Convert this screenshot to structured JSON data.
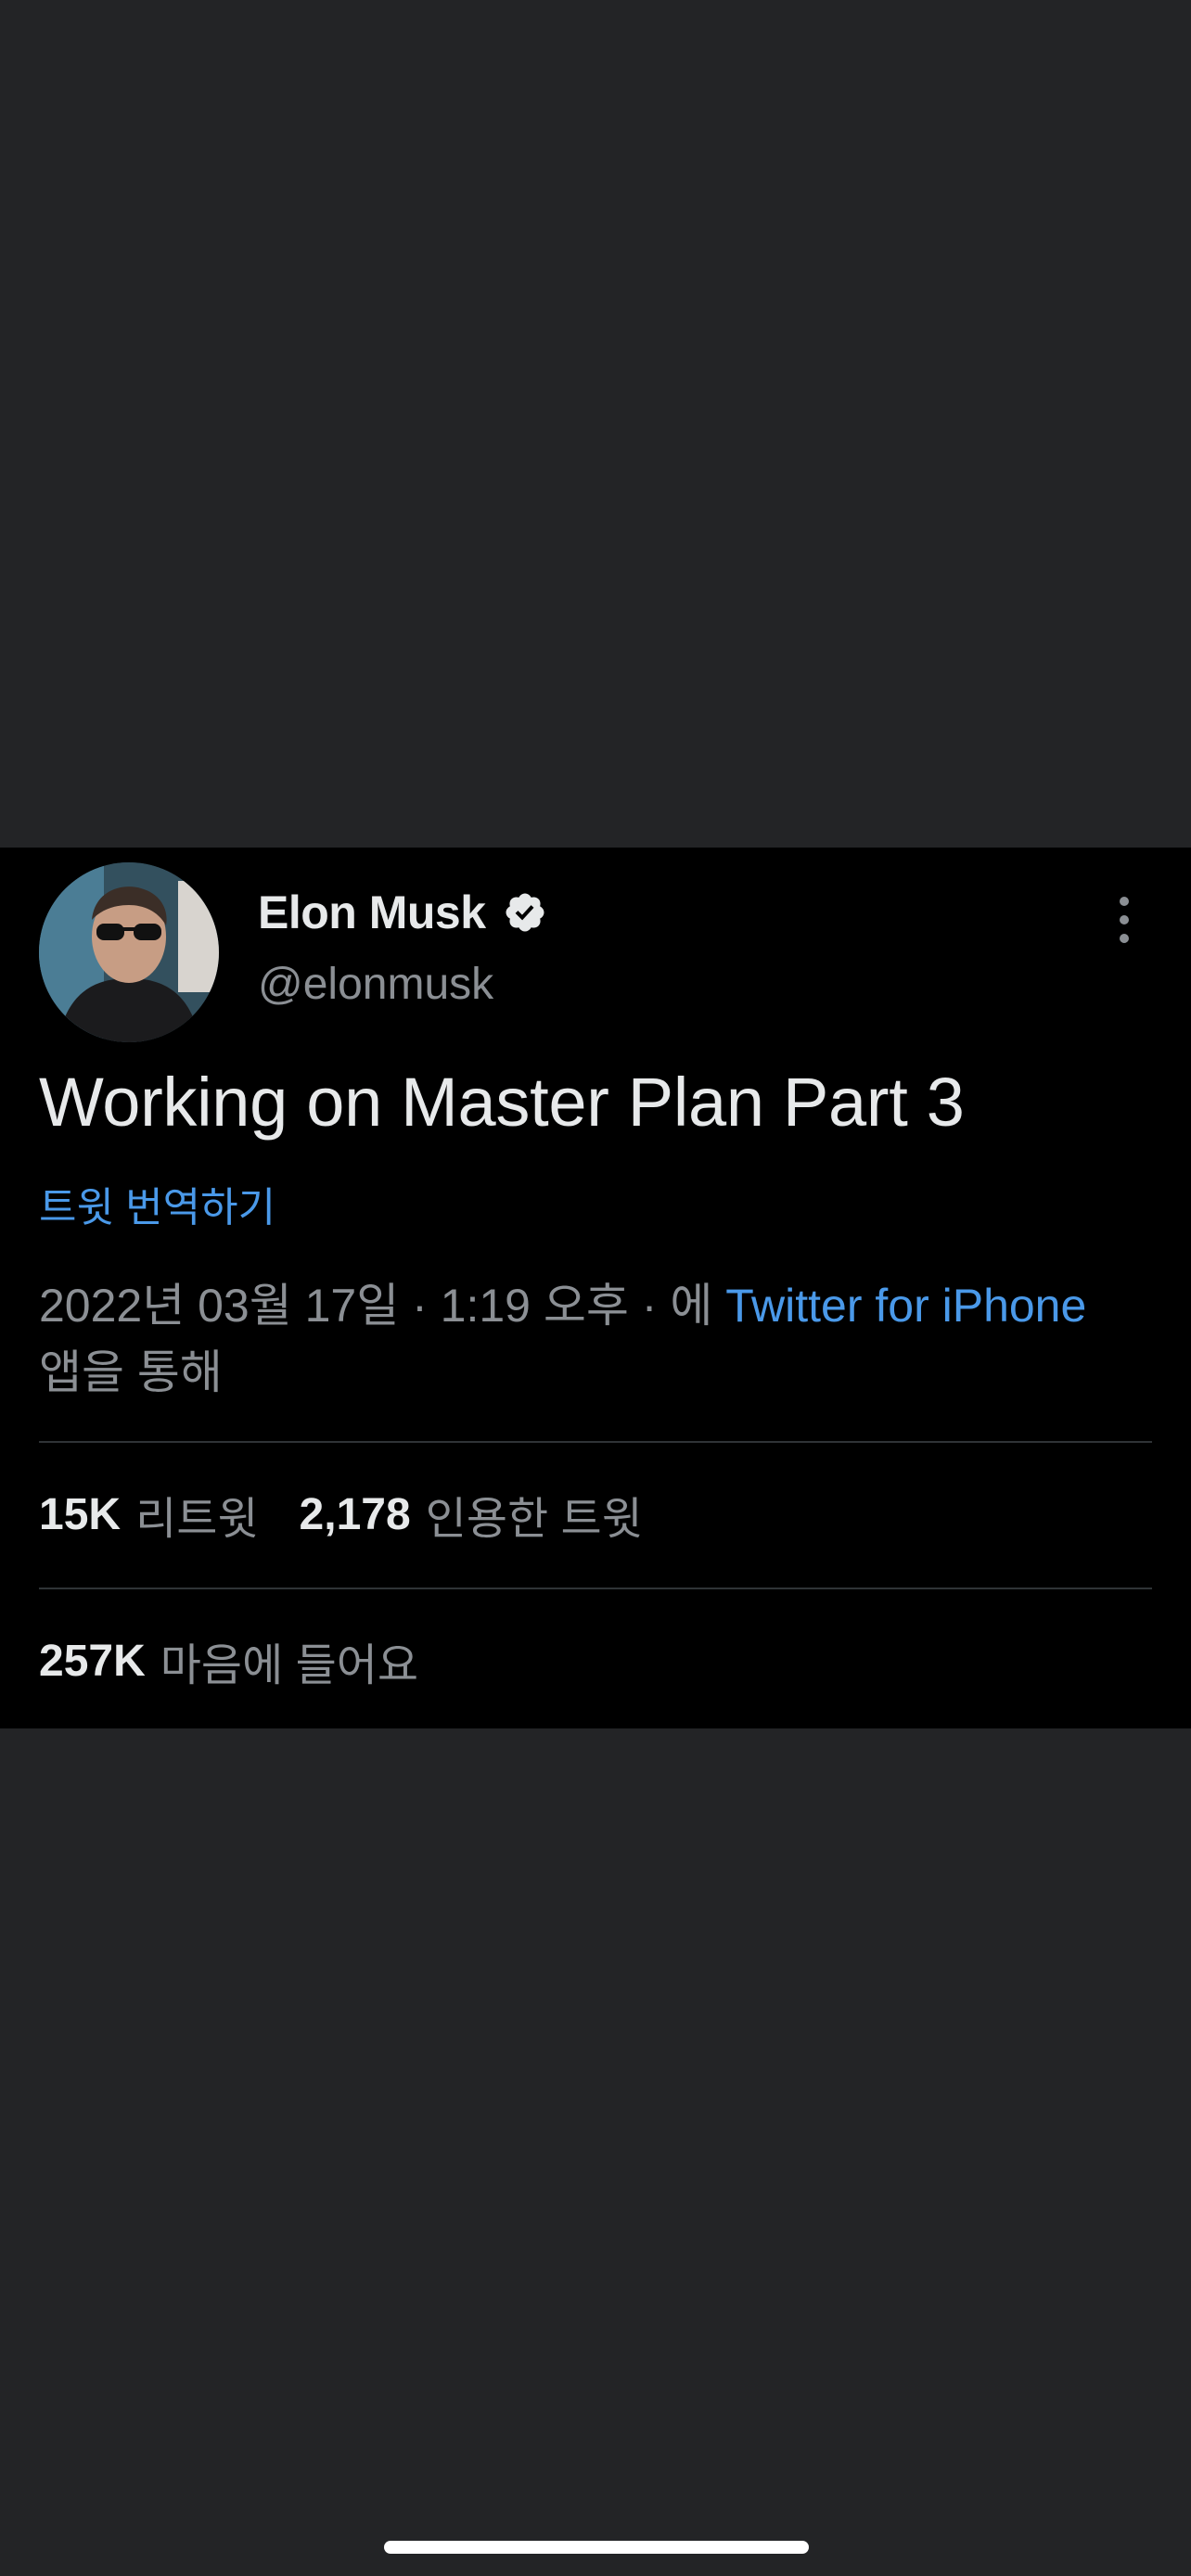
{
  "tweet": {
    "author": {
      "name": "Elon Musk",
      "handle": "@elonmusk",
      "verified": true
    },
    "text": "Working on Master Plan Part 3",
    "translate_label": "트윗 번역하기",
    "meta": {
      "timestamp": "2022년 03월 17일 · 1:19 오후 · 에",
      "source": "Twitter for iPhone",
      "suffix": "앱을 통해"
    },
    "stats": {
      "retweets_count": "15K",
      "retweets_label": "리트윗",
      "quotes_count": "2,178",
      "quotes_label": "인용한 트윗",
      "likes_count": "257K",
      "likes_label": "마음에 들어요"
    }
  },
  "icons": {
    "verified": "verified-badge-icon",
    "more": "more-vertical-icon"
  },
  "colors": {
    "background": "#232426",
    "card": "#000000",
    "link": "#4a99e9",
    "primary_text": "#e7e9ea",
    "secondary_text": "#8b8f94"
  }
}
